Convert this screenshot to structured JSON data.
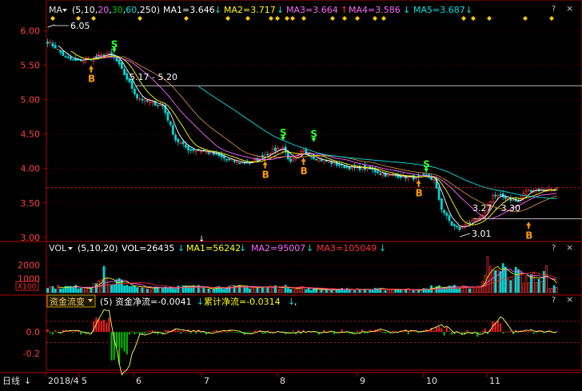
{
  "price_header": {
    "indicator": "MA",
    "params_prefix": "(5,10,",
    "param_20": "20",
    "param_30": "30",
    "param_60": "60",
    "param_250": "250)",
    "ma1": "MA1=3.646",
    "ma2": "MA2=3.717",
    "ma3": "MA3=3.664",
    "ma4": "MA4=3.586",
    "ma5": "MA5=3.687",
    "arrow_down": "↓",
    "arrow_up": "↑"
  },
  "vol_header": {
    "indicator": "VOL",
    "params": "(5,10,20)",
    "vol": "VOL=26435",
    "ma1": "MA1=56242",
    "ma2": "MA2=95007",
    "ma3": "MA3=105049"
  },
  "fund_header": {
    "indicator": "资金流变",
    "param": "(5)",
    "net": "资金净流=-0.0041",
    "cumulative": "累计净流=-0.0314",
    "comma": ","
  },
  "panel_buttons": {
    "help": "?",
    "close": "×"
  },
  "volume_unit": "X100",
  "bottom_bar": {
    "period": "日线",
    "arrow": "↓"
  },
  "colors": {
    "background": "#000000",
    "up": "#ff3232",
    "down": "#00d7d7",
    "ma1": "#ffffff",
    "ma2": "#ffff00",
    "ma3": "#ff66ff",
    "ma4": "#00cc00",
    "ma5": "#00e0e0",
    "grid": "#8b0000",
    "buy_signal": "#ff9900",
    "sell_signal": "#33ff33"
  },
  "chart_data": {
    "type": "candlestick",
    "y_axis": {
      "ticks": [
        "6.00",
        "5.50",
        "5.00",
        "4.50",
        "4.00",
        "3.50",
        "3.00"
      ],
      "tick_values": [
        6.0,
        5.5,
        5.0,
        4.5,
        4.0,
        3.5,
        3.0
      ],
      "range": [
        2.94,
        6.19
      ]
    },
    "x_axis": {
      "labels": [
        "2018/4",
        "5",
        "6",
        "7",
        "8",
        "9",
        "10",
        "11"
      ]
    },
    "price_annotations": {
      "high_label": "6.05",
      "high_value": 6.05,
      "range_label_1": "5.17 - 5.20",
      "range_value_1": 5.2,
      "range_label_2": "3.27 - 3.30",
      "range_value_2": 3.27,
      "low_label": "3.01",
      "low_value": 3.01
    },
    "signals": [
      {
        "type": "B",
        "index": 17,
        "price": 5.52
      },
      {
        "type": "S",
        "index": 26,
        "price": 5.66
      },
      {
        "type": "B",
        "index": 85,
        "price": 4.13
      },
      {
        "type": "S",
        "index": 92,
        "price": 4.38
      },
      {
        "type": "B",
        "index": 100,
        "price": 4.18
      },
      {
        "type": "S",
        "index": 104,
        "price": 4.36
      },
      {
        "type": "B",
        "index": 145,
        "price": 3.86
      },
      {
        "type": "S",
        "index": 148,
        "price": 3.92
      },
      {
        "type": "B",
        "index": 188,
        "price": 3.25
      }
    ],
    "anchors": [
      [
        0,
        5.84
      ],
      [
        3,
        5.76
      ],
      [
        7,
        5.61
      ],
      [
        11,
        5.56
      ],
      [
        15,
        5.59
      ],
      [
        19,
        5.61
      ],
      [
        23,
        5.66
      ],
      [
        26,
        5.62
      ],
      [
        29,
        5.43
      ],
      [
        32,
        5.24
      ],
      [
        35,
        5.03
      ],
      [
        40,
        4.96
      ],
      [
        45,
        4.91
      ],
      [
        50,
        4.42
      ],
      [
        55,
        4.28
      ],
      [
        60,
        4.26
      ],
      [
        65,
        4.21
      ],
      [
        70,
        4.13
      ],
      [
        75,
        4.08
      ],
      [
        80,
        4.09
      ],
      [
        84,
        4.18
      ],
      [
        88,
        4.26
      ],
      [
        92,
        4.31
      ],
      [
        95,
        4.08
      ],
      [
        100,
        4.26
      ],
      [
        104,
        4.16
      ],
      [
        110,
        4.09
      ],
      [
        117,
        4.02
      ],
      [
        125,
        4.0
      ],
      [
        132,
        3.91
      ],
      [
        138,
        3.89
      ],
      [
        144,
        3.86
      ],
      [
        148,
        3.89
      ],
      [
        151,
        3.83
      ],
      [
        154,
        3.42
      ],
      [
        158,
        3.18
      ],
      [
        161,
        3.12
      ],
      [
        164,
        3.21
      ],
      [
        167,
        3.23
      ],
      [
        170,
        3.3
      ],
      [
        174,
        3.61
      ],
      [
        179,
        3.58
      ],
      [
        184,
        3.51
      ],
      [
        187,
        3.68
      ],
      [
        190,
        3.69
      ],
      [
        195,
        3.69
      ],
      [
        199,
        3.71
      ]
    ],
    "candle_count": 200,
    "volume": {
      "ticks": [
        "2000",
        "1000"
      ],
      "tick_values": [
        2000,
        1000
      ],
      "max": 2650
    },
    "fund_flow": {
      "ticks": [
        "0.0",
        "-0.2"
      ],
      "tick_values": [
        0.0,
        -0.2
      ],
      "range": [
        -0.36,
        0.22
      ],
      "dashed_ref_values": [
        0.1,
        -0.1
      ]
    }
  }
}
